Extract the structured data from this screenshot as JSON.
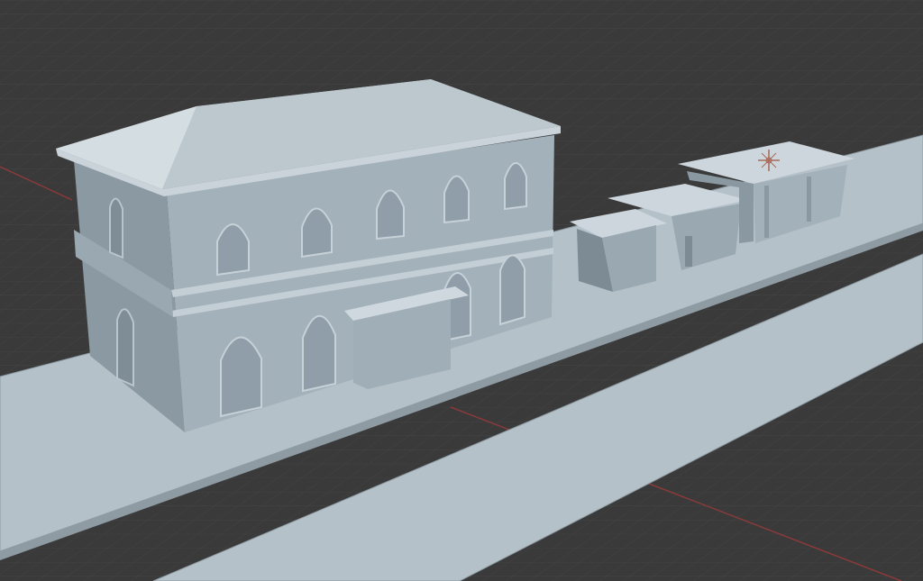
{
  "viewport": {
    "background": "#3a3a3a",
    "grid_color": "#454545",
    "axis_color": "#8a3a3a",
    "model_color": "#a9b7c0",
    "platform_color": "#b5c2ca",
    "gizmo_icon": "light-cross-icon"
  }
}
